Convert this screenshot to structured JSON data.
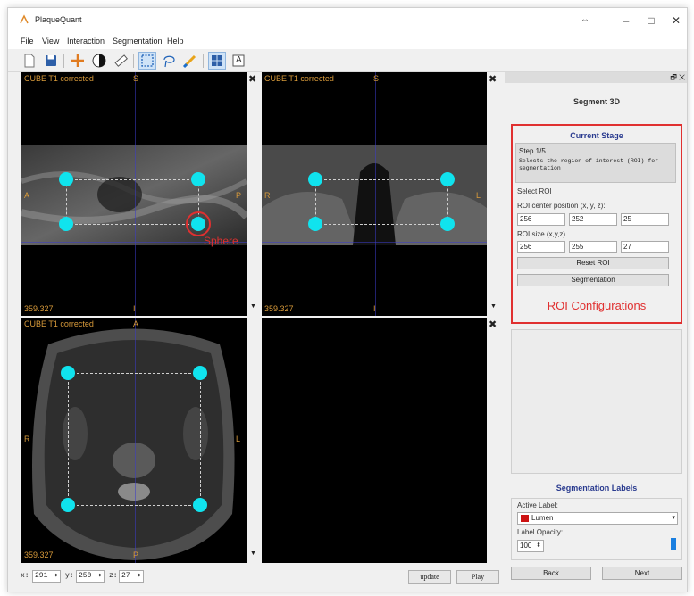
{
  "window": {
    "title": "PlaqueQuant",
    "controls": {
      "restore": "⇔",
      "minimize": "–",
      "maximize": "□",
      "close": "✕"
    }
  },
  "menu": [
    "File",
    "View",
    "Interaction",
    "Segmentation",
    "Help"
  ],
  "toolbar": {
    "icons": [
      "new-file",
      "save",
      "navigation-crosshair",
      "window-level",
      "ruler",
      "roi-select",
      "contour-lasso",
      "brush",
      "four-view-layout",
      "annotation-text"
    ],
    "text_tool_glyph": "A"
  },
  "viewports": {
    "top_left": {
      "series": "CUBE T1 corrected",
      "top": "S",
      "bottom": "I",
      "left": "A",
      "right": "P",
      "value": "359.327"
    },
    "top_right": {
      "series": "CUBE T1 corrected",
      "top": "S",
      "left": "R",
      "right": "L",
      "value": "359.327",
      "bottom": "I"
    },
    "bottom_left": {
      "series": "CUBE T1 corrected",
      "top": "A",
      "bottom": "P",
      "left": "R",
      "right": "L",
      "value": "359.327"
    },
    "maximize_glyph": "✖"
  },
  "annotations": {
    "sphere": "Sphere",
    "roi_config": "ROI Configurations"
  },
  "coords": {
    "x_label": "x:",
    "x_value": "291",
    "y_label": "y:",
    "y_value": "250",
    "z_label": "z:",
    "z_value": "27",
    "update_button": "update",
    "play_button": "Play"
  },
  "panel": {
    "dock_buttons": "🗗 ✕",
    "title": "Segment 3D",
    "current_stage": "Current Stage",
    "step": "Step 1/5",
    "step_desc": "Selects the region of interest (ROI) for segmentation",
    "select_roi": "Select ROI",
    "center_label": "ROI center position (x, y, z):",
    "center": [
      "256",
      "252",
      "25"
    ],
    "size_label": "ROI size (x,y,z)",
    "size": [
      "256",
      "255",
      "27"
    ],
    "reset_button": "Reset ROI",
    "segmentation_button": "Segmentation",
    "labels_title": "Segmentation Labels",
    "active_label": "Active Label:",
    "active_value": "Lumen",
    "active_color": "#cc1111",
    "opacity_label": "Label Opacity:",
    "opacity_value": "100",
    "back_button": "Back",
    "next_button": "Next"
  }
}
